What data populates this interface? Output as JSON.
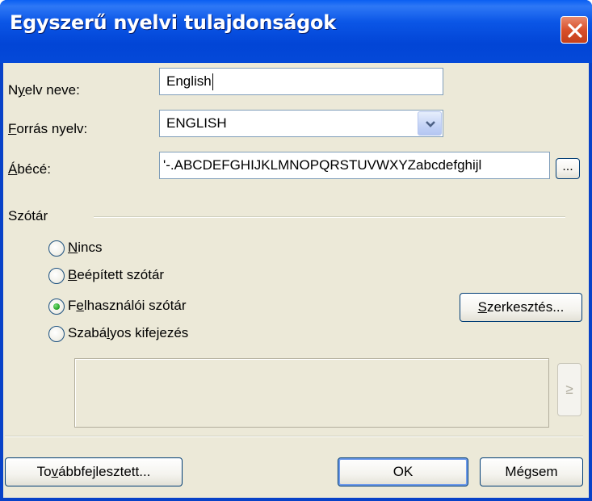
{
  "window": {
    "title": "Egyszerű nyelvi tulajdonságok"
  },
  "fields": {
    "language_name": {
      "label_pre": "N",
      "label_u": "y",
      "label_post": "elv neve:",
      "value": "English"
    },
    "source_language": {
      "label_pre": "",
      "label_u": "F",
      "label_post": "orrás nyelv:",
      "value": "ENGLISH"
    },
    "alphabet": {
      "label_pre": "",
      "label_u": "Á",
      "label_post": "bécé:",
      "value": "'-.ABCDEFGHIJKLMNOPQRSTUVWXYZabcdefghijl",
      "browse_label": "..."
    }
  },
  "dictionary": {
    "group_label": "Szótár",
    "options": [
      {
        "pre": "",
        "u": "N",
        "post": "incs",
        "checked": false
      },
      {
        "pre": "",
        "u": "B",
        "post": "eépített szótár",
        "checked": false
      },
      {
        "pre": "F",
        "u": "e",
        "post": "lhasználói szótár",
        "checked": true
      },
      {
        "pre": "Szabá",
        "u": "l",
        "post": "yos kifejezés",
        "checked": false
      }
    ],
    "edit_button": {
      "pre": "",
      "u": "S",
      "post": "zerkesztés..."
    },
    "arrow_button": "≥"
  },
  "footer": {
    "advanced": {
      "pre": "To",
      "u": "v",
      "post": "ábbfejlesztett..."
    },
    "ok": "OK",
    "cancel": "Mégsem"
  },
  "colors": {
    "titlebar": "#0a5ff2",
    "client": "#ece9d8",
    "close": "#d9512c"
  }
}
